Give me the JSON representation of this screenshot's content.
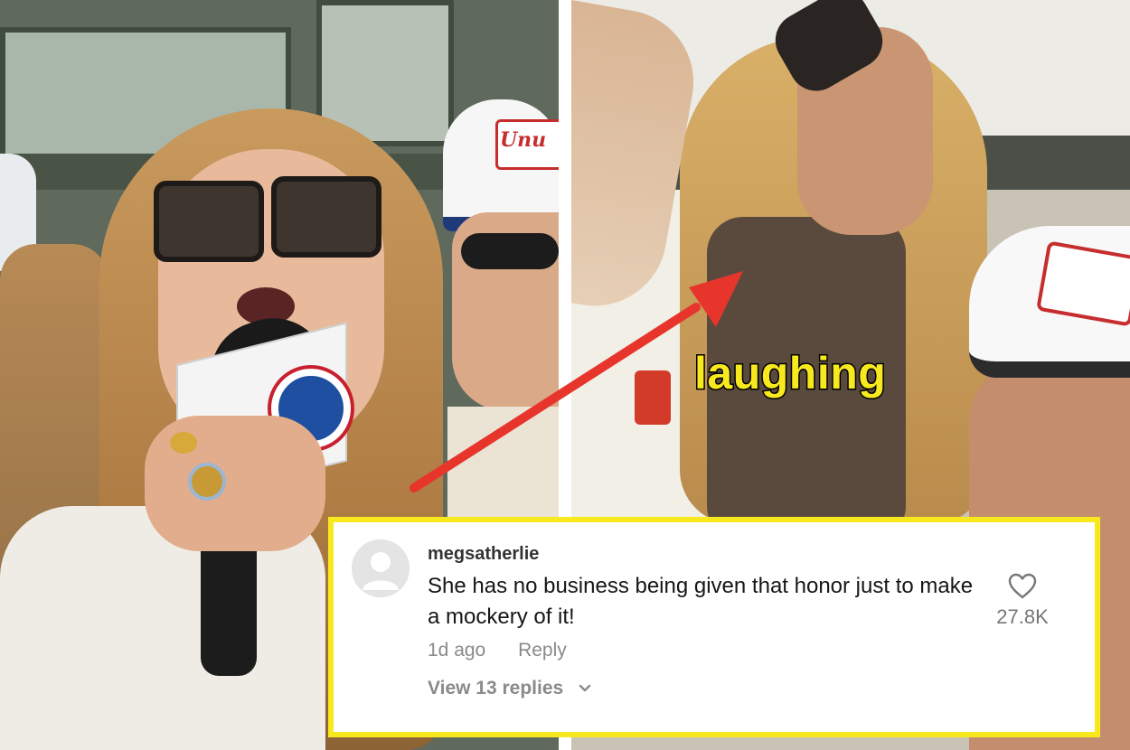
{
  "panels": {
    "left": {
      "hat_text": "Unu",
      "mic_logo": "cubs-logo"
    },
    "right": {
      "caption": "laughing"
    }
  },
  "arrow": {
    "color": "#e7352b",
    "direction": "from left panel toward right panel"
  },
  "comment": {
    "border_color": "#f7e91e",
    "avatar_icon": "default-avatar-icon",
    "username": "megsatherlie",
    "text": "She has no business being given that honor just to make a mockery of it!",
    "time_ago": "1d ago",
    "reply_label": "Reply",
    "view_replies_label": "View 13 replies",
    "like_icon": "heart-outline-icon",
    "like_count": "27.8K"
  },
  "colors": {
    "caption_yellow": "#f7e91e",
    "arrow_red": "#e7352b"
  }
}
